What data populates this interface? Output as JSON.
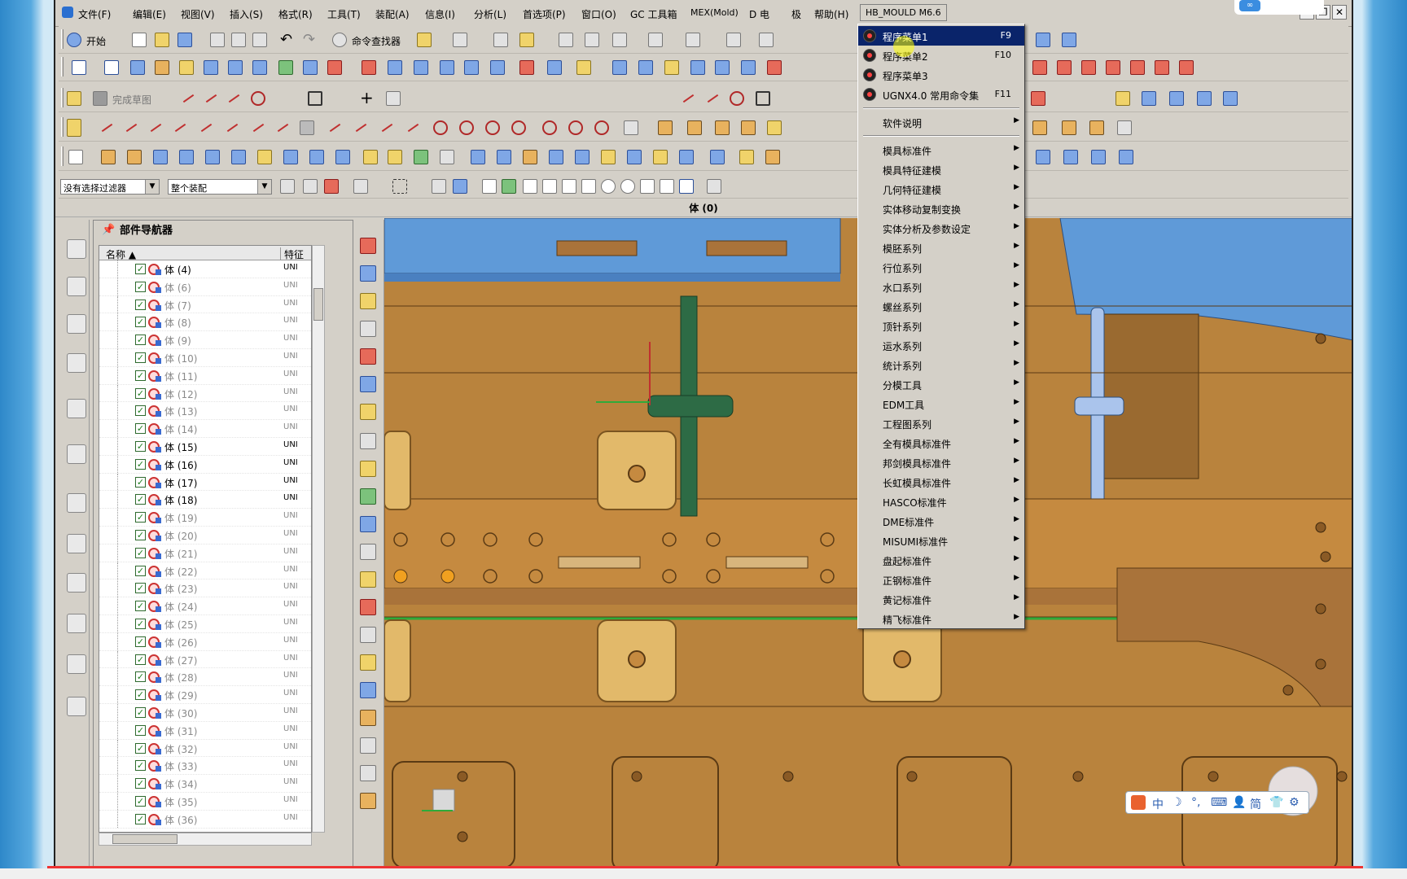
{
  "menubar": {
    "items": [
      "文件(F)",
      "编辑(E)",
      "视图(V)",
      "插入(S)",
      "格式(R)",
      "工具(T)",
      "装配(A)",
      "信息(I)",
      "分析(L)",
      "首选项(P)",
      "窗口(O)",
      "GC 工具箱",
      "MEX(Mold)",
      "D 电",
      "极",
      "帮助(H)"
    ],
    "active": "HB_MOULD M6.6",
    "window_controls": [
      "‒",
      "❐",
      "✕"
    ]
  },
  "toolbar": {
    "start_label": "开始",
    "cmd_finder_label": "命令查找器",
    "sketch_label": "完成草图"
  },
  "filterbar": {
    "type_filter": "没有选择过滤器",
    "scope_filter": "整个装配"
  },
  "viewport": {
    "title": "体 (0)"
  },
  "part_navigator": {
    "title": "部件导航器",
    "columns": [
      "名称",
      "特征"
    ],
    "rows": [
      {
        "name": "体 (4)",
        "feature": "UNI",
        "dim": false
      },
      {
        "name": "体 (6)",
        "feature": "UNI",
        "dim": true
      },
      {
        "name": "体 (7)",
        "feature": "UNI",
        "dim": true
      },
      {
        "name": "体 (8)",
        "feature": "UNI",
        "dim": true
      },
      {
        "name": "体 (9)",
        "feature": "UNI",
        "dim": true
      },
      {
        "name": "体 (10)",
        "feature": "UNI",
        "dim": true
      },
      {
        "name": "体 (11)",
        "feature": "UNI",
        "dim": true
      },
      {
        "name": "体 (12)",
        "feature": "UNI",
        "dim": true
      },
      {
        "name": "体 (13)",
        "feature": "UNI",
        "dim": true
      },
      {
        "name": "体 (14)",
        "feature": "UNI",
        "dim": true
      },
      {
        "name": "体 (15)",
        "feature": "UNI",
        "dim": false
      },
      {
        "name": "体 (16)",
        "feature": "UNI",
        "dim": false
      },
      {
        "name": "体 (17)",
        "feature": "UNI",
        "dim": false
      },
      {
        "name": "体 (18)",
        "feature": "UNI",
        "dim": false
      },
      {
        "name": "体 (19)",
        "feature": "UNI",
        "dim": true
      },
      {
        "name": "体 (20)",
        "feature": "UNI",
        "dim": true
      },
      {
        "name": "体 (21)",
        "feature": "UNI",
        "dim": true
      },
      {
        "name": "体 (22)",
        "feature": "UNI",
        "dim": true
      },
      {
        "name": "体 (23)",
        "feature": "UNI",
        "dim": true
      },
      {
        "name": "体 (24)",
        "feature": "UNI",
        "dim": true
      },
      {
        "name": "体 (25)",
        "feature": "UNI",
        "dim": true
      },
      {
        "name": "体 (26)",
        "feature": "UNI",
        "dim": true
      },
      {
        "name": "体 (27)",
        "feature": "UNI",
        "dim": true
      },
      {
        "name": "体 (28)",
        "feature": "UNI",
        "dim": true
      },
      {
        "name": "体 (29)",
        "feature": "UNI",
        "dim": true
      },
      {
        "name": "体 (30)",
        "feature": "UNI",
        "dim": true
      },
      {
        "name": "体 (31)",
        "feature": "UNI",
        "dim": true
      },
      {
        "name": "体 (32)",
        "feature": "UNI",
        "dim": true
      },
      {
        "name": "体 (33)",
        "feature": "UNI",
        "dim": true
      },
      {
        "name": "体 (34)",
        "feature": "UNI",
        "dim": true
      },
      {
        "name": "体 (35)",
        "feature": "UNI",
        "dim": true
      },
      {
        "name": "体 (36)",
        "feature": "UNI",
        "dim": true
      }
    ]
  },
  "context_menu": {
    "items": [
      {
        "label": "程序菜单1",
        "key": "F9",
        "icon": true,
        "highlight": true
      },
      {
        "label": "程序菜单2",
        "key": "F10",
        "icon": true
      },
      {
        "label": "程序菜单3",
        "key": "",
        "icon": true
      },
      {
        "label": "UGNX4.0 常用命令集",
        "key": "F11",
        "icon": true
      },
      {
        "sep": true
      },
      {
        "label": "软件说明",
        "arrow": true
      },
      {
        "sep": true
      },
      {
        "label": "模具标准件",
        "arrow": true
      },
      {
        "label": "模具特征建模",
        "arrow": true
      },
      {
        "label": "几何特征建模",
        "arrow": true
      },
      {
        "label": "实体移动复制变换",
        "arrow": true
      },
      {
        "label": "实体分析及参数设定",
        "arrow": true
      },
      {
        "label": "模胚系列",
        "arrow": true
      },
      {
        "label": "行位系列",
        "arrow": true
      },
      {
        "label": "水口系列",
        "arrow": true
      },
      {
        "label": "螺丝系列",
        "arrow": true
      },
      {
        "label": "顶针系列",
        "arrow": true
      },
      {
        "label": "运水系列",
        "arrow": true
      },
      {
        "label": "统计系列",
        "arrow": true
      },
      {
        "label": "分模工具",
        "arrow": true
      },
      {
        "label": "EDM工具",
        "arrow": true
      },
      {
        "label": "工程图系列",
        "arrow": true
      },
      {
        "label": "全有模具标准件",
        "arrow": true
      },
      {
        "label": "邦剑模具标准件",
        "arrow": true
      },
      {
        "label": "长虹模具标准件",
        "arrow": true
      },
      {
        "label": "HASCO标准件",
        "arrow": true
      },
      {
        "label": "DME标准件",
        "arrow": true
      },
      {
        "label": "MISUMI标准件",
        "arrow": true
      },
      {
        "label": "盘起标准件",
        "arrow": true
      },
      {
        "label": "正钢标准件",
        "arrow": true
      },
      {
        "label": "黄记标准件",
        "arrow": true
      },
      {
        "label": "精飞标准件",
        "arrow": true
      }
    ]
  },
  "ime": {
    "items": [
      "中",
      "简"
    ]
  },
  "colors": {
    "mould_orange": "#b9833d",
    "part_blue": "#5f9ad8",
    "highlight_navy": "#0a246a",
    "runner_green": "#2d6b45"
  }
}
